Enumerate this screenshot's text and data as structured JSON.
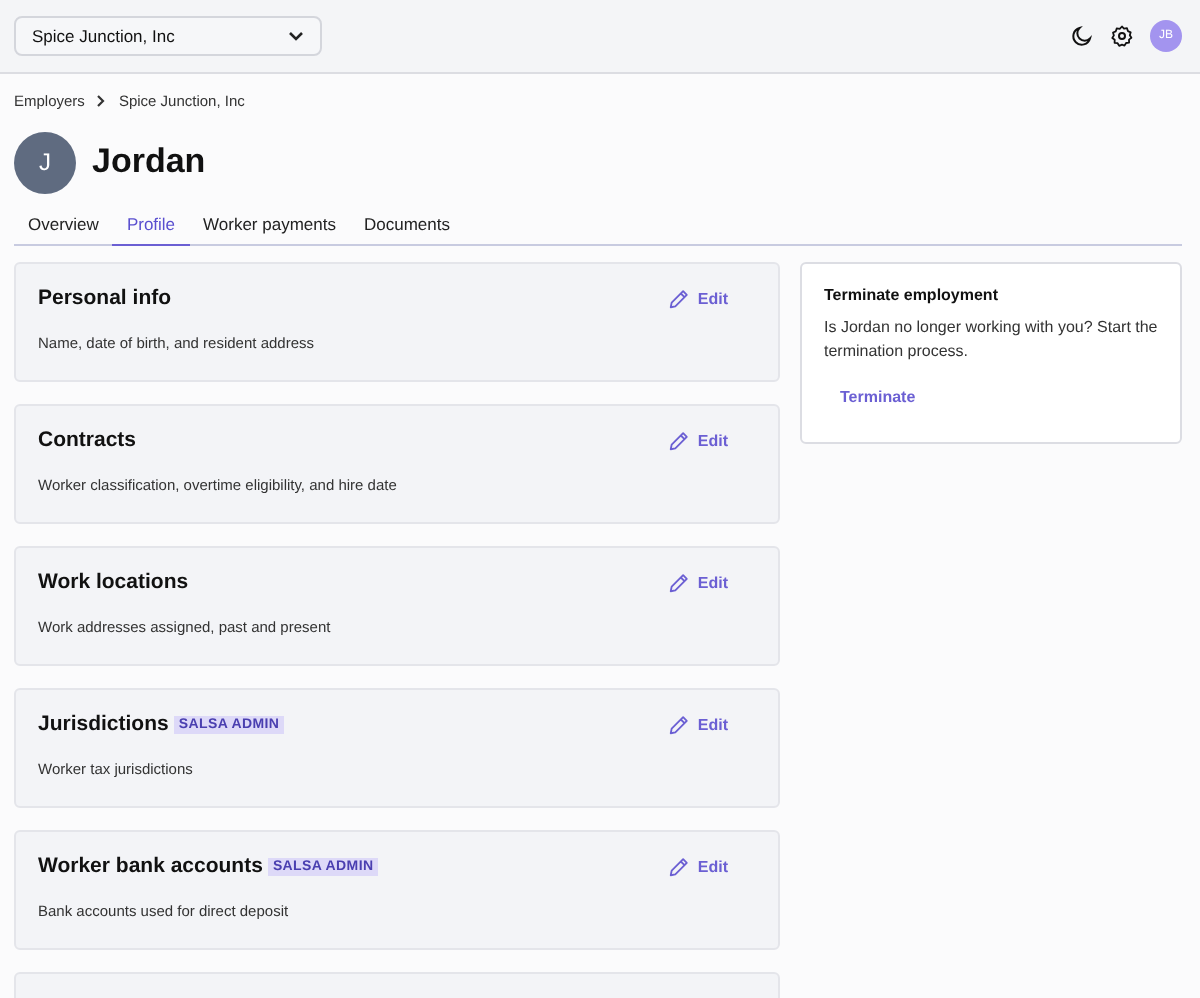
{
  "employer_select": {
    "value": "Spice Junction, Inc"
  },
  "user_avatar": {
    "initials": "JB"
  },
  "breadcrumbs": [
    "Employers",
    "Spice Junction, Inc"
  ],
  "worker": {
    "initial": "J",
    "name": "Jordan"
  },
  "tabs": [
    {
      "label": "Overview",
      "selected": false
    },
    {
      "label": "Profile",
      "selected": true
    },
    {
      "label": "Worker payments",
      "selected": false
    },
    {
      "label": "Documents",
      "selected": false
    }
  ],
  "sections": [
    {
      "title": "Personal info",
      "description": "Name, date of birth, and resident address",
      "action": "Edit"
    },
    {
      "title": "Contracts",
      "description": "Worker classification, overtime eligibility, and hire date",
      "action": "Edit"
    },
    {
      "title": "Work locations",
      "description": "Work addresses assigned, past and present",
      "action": "Edit"
    },
    {
      "title": "Jurisdictions",
      "badge": "SALSA ADMIN",
      "description": "Worker tax jurisdictions",
      "action": "Edit"
    },
    {
      "title": "Worker bank accounts",
      "badge": "SALSA ADMIN",
      "description": "Bank accounts used for direct deposit",
      "action": "Edit"
    }
  ],
  "terminate_card": {
    "title": "Terminate employment",
    "description": "Is Jordan no longer working with you? Start the termination process.",
    "action": "Terminate"
  }
}
